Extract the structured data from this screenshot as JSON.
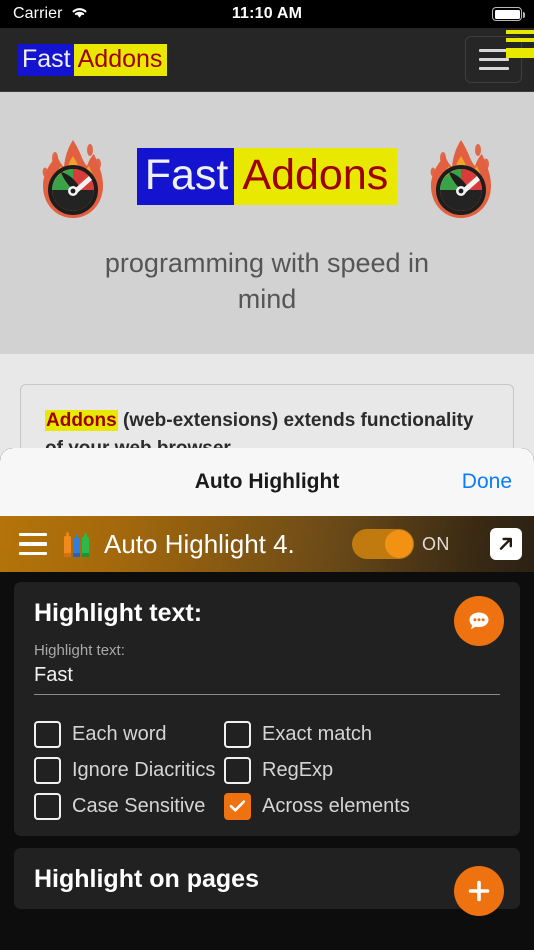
{
  "status_bar": {
    "carrier": "Carrier",
    "wifi_icon": "wifi-icon",
    "time": "11:10 AM",
    "battery_icon": "battery-full-icon"
  },
  "navbar": {
    "brand_part1": "Fast",
    "brand_part2": "Addons",
    "menu_icon": "hamburger-menu-icon"
  },
  "hero": {
    "logo_icon": "flame-speedometer-logo",
    "title_part1": "Fast",
    "title_part2": "Addons",
    "subtitle": "programming with speed in mind"
  },
  "content": {
    "paragraph_lead": "Addons",
    "paragraph_rest": " (web-extensions) extends functionality of your web browser."
  },
  "sheet": {
    "title": "Auto Highlight",
    "done_label": "Done"
  },
  "extension": {
    "menu_icon": "hamburger-menu-icon",
    "markers_icon": "highlighter-markers-icon",
    "title": "Auto Highlight 4.",
    "toggle_state": "ON",
    "toggle_on": true,
    "popout_icon": "external-link-icon"
  },
  "highlight_panel": {
    "title": "Highlight text:",
    "field_label": "Highlight text:",
    "field_value": "Fast",
    "field_placeholder": "Highlight text:",
    "comment_icon": "chat-bubble-icon",
    "checkboxes": [
      {
        "label": "Each word",
        "checked": false
      },
      {
        "label": "Exact match",
        "checked": false
      },
      {
        "label": "Ignore Diacritics",
        "checked": false
      },
      {
        "label": "RegExp",
        "checked": false
      },
      {
        "label": "Case Sensitive",
        "checked": false
      },
      {
        "label": "Across elements",
        "checked": true
      }
    ]
  },
  "pages_panel": {
    "title": "Highlight on pages",
    "add_icon": "plus-icon"
  },
  "colors": {
    "accent_orange": "#ef7211",
    "highlight_yellow": "#e8e800",
    "highlight_blue": "#1414d0",
    "link_blue": "#0a7cff",
    "addons_red": "#9e0000"
  }
}
